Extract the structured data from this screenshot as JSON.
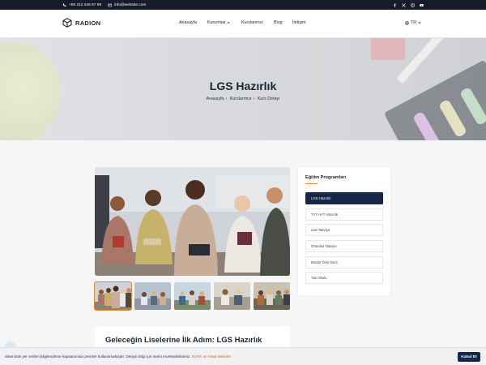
{
  "topbar": {
    "phone": "+90 212 345 67 89",
    "email": "info@website.com",
    "social_icons": [
      "facebook-icon",
      "x-icon",
      "instagram-icon",
      "youtube-icon"
    ]
  },
  "nav": {
    "logo_text": "RADION",
    "menu": [
      {
        "label": "Anasayfa"
      },
      {
        "label": "Kurumsal",
        "has_dropdown": true
      },
      {
        "label": "Kurslarımız"
      },
      {
        "label": "Blog"
      },
      {
        "label": "İletişim"
      }
    ],
    "language": "TR"
  },
  "hero": {
    "title": "LGS Hazırlık",
    "breadcrumb": [
      "Anasayfa",
      "Kurslarımız",
      "Kurs Detayı"
    ]
  },
  "sidebar": {
    "title": "Eğitim Programları",
    "items": [
      {
        "label": "LGS Hazırlık",
        "active": true
      },
      {
        "label": "TYT-AYT Hazırlık",
        "active": false
      },
      {
        "label": "Lise Takviye",
        "active": false
      },
      {
        "label": "Ortaokul Takviye",
        "active": false
      },
      {
        "label": "Birebir Özel Ders",
        "active": false
      },
      {
        "label": "Yaz Okulu",
        "active": false
      }
    ]
  },
  "course": {
    "title": "Geleceğin Liselerine İlk Adım: LGS Hazırlık"
  },
  "cookie": {
    "text": "Sitemizde yer verilen bilgilendirme kapsamında çerezler kullanılmaktadır. Detaylı bilgi için metni inceleyebilirsiniz.",
    "link": "KVKK ve Yasal Metinler",
    "button": "Kabul Et"
  },
  "colors": {
    "accent": "#e08a2c",
    "navy": "#14264a",
    "topbar": "#141b2a"
  }
}
